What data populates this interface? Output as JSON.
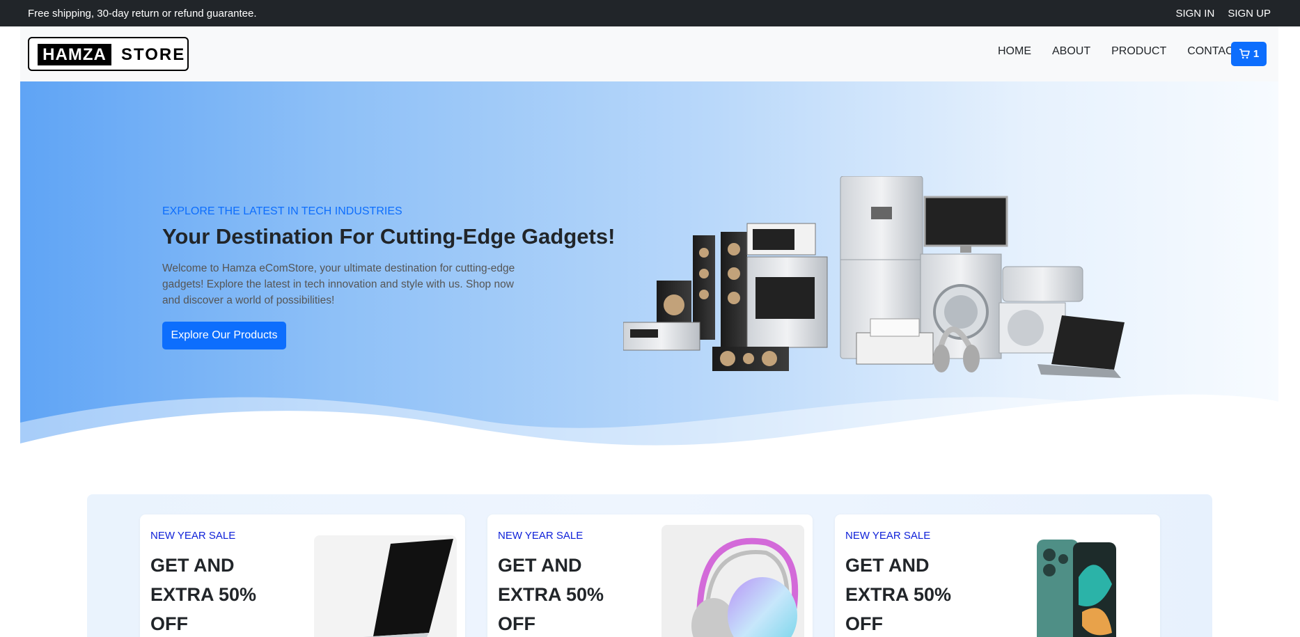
{
  "topbar": {
    "message": "Free shipping, 30-day return or refund guarantee.",
    "sign_in": "SIGN IN",
    "sign_up": "SIGN UP"
  },
  "navbar": {
    "logo_part1": "HAMZA",
    "logo_part2": "STORE",
    "links": [
      "HOME",
      "ABOUT",
      "PRODUCT",
      "CONTACT"
    ],
    "cart_count": "1",
    "cart_icon": "cart-icon"
  },
  "hero": {
    "subtitle": "EXPLORE THE LATEST IN TECH INDUSTRIES",
    "title": "Your Destination For Cutting-Edge Gadgets!",
    "description": "Welcome to Hamza eComStore, your ultimate destination for cutting-edge gadgets! Explore the latest in tech innovation and style with us. Shop now and discover a world of possibilities!",
    "button": "Explore Our Products",
    "image": "electronics-appliances-image"
  },
  "promos": [
    {
      "tag": "NEW YEAR SALE",
      "headline": "GET AND EXTRA 50% OFF",
      "image": "laptop-image"
    },
    {
      "tag": "NEW YEAR SALE",
      "headline": "GET AND EXTRA 50% OFF",
      "image": "headphones-image"
    },
    {
      "tag": "NEW YEAR SALE",
      "headline": "GET AND EXTRA 50% OFF",
      "image": "foldable-phone-image"
    }
  ],
  "colors": {
    "primary": "#0d6efd",
    "topbar": "#212529",
    "promo_tag": "#0d1fd8"
  }
}
